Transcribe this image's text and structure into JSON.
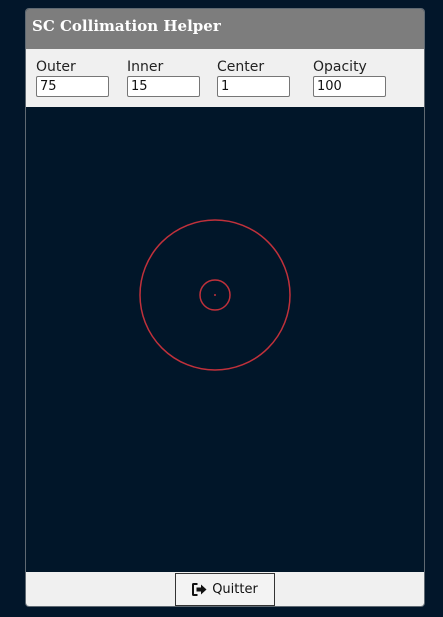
{
  "window": {
    "title": "SC Collimation Helper"
  },
  "controls": {
    "outer": {
      "label": "Outer",
      "value": "75"
    },
    "inner": {
      "label": "Inner",
      "value": "15"
    },
    "center": {
      "label": "Center",
      "value": "1"
    },
    "opacity": {
      "label": "Opacity",
      "value": "100"
    }
  },
  "reticle": {
    "outer_radius": 75,
    "inner_radius": 15,
    "center_radius": 1,
    "opacity_percent": 100,
    "stroke_color": "#c0313b",
    "background_color": "#011629"
  },
  "footer": {
    "quit_label": "Quitter",
    "quit_icon": "sign-out-icon"
  }
}
